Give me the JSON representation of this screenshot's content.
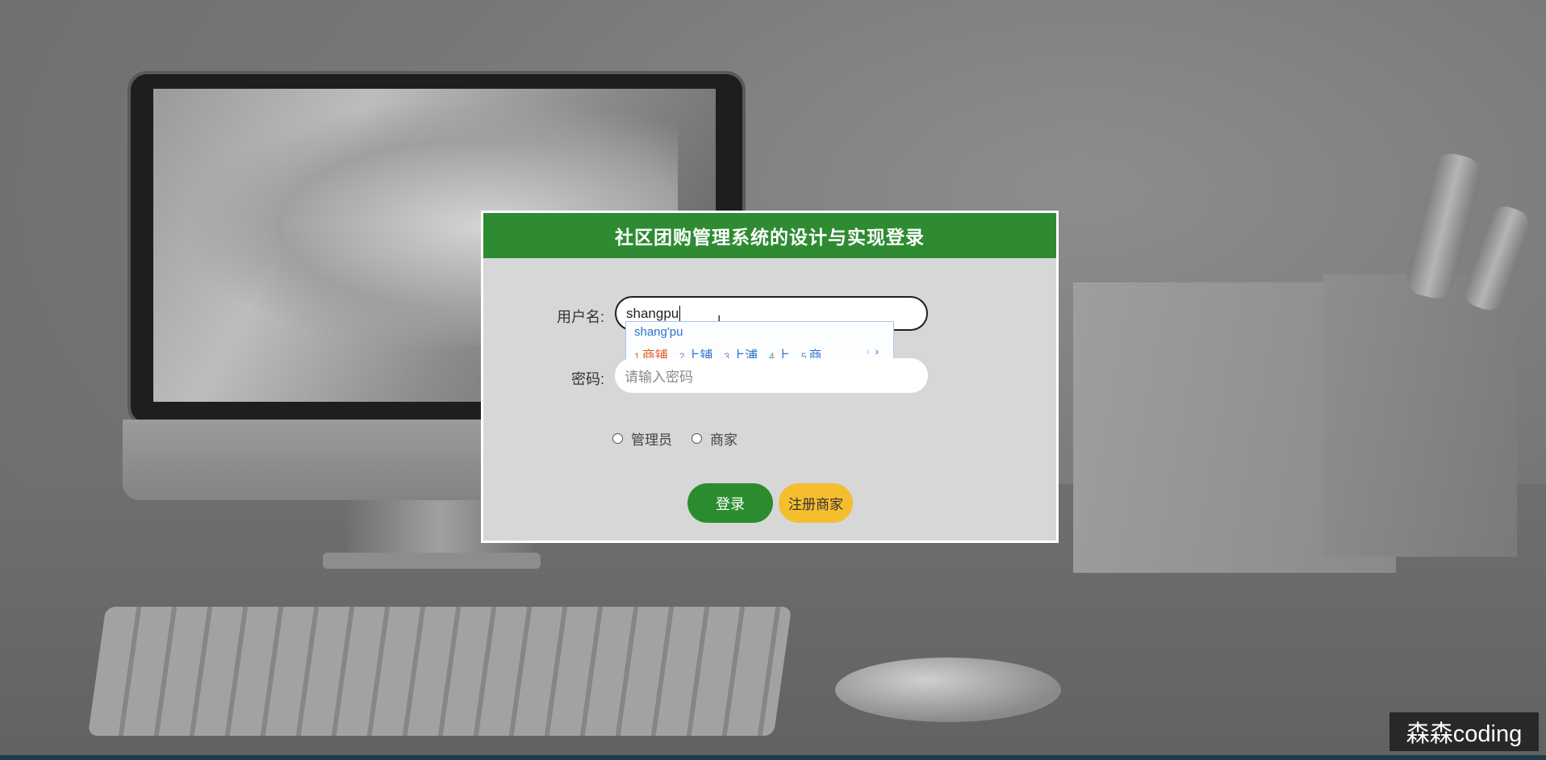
{
  "dialog": {
    "title": "社区团购管理系统的设计与实现登录",
    "username_label": "用户名:",
    "username_value": "shangpu",
    "password_label": "密码:",
    "password_placeholder": "请输入密码",
    "roles": [
      {
        "label": "管理员",
        "selected": false
      },
      {
        "label": "商家",
        "selected": false
      }
    ],
    "login_button": "登录",
    "register_button": "注册商家"
  },
  "ime": {
    "composition": "shang'pu",
    "candidates": [
      {
        "num": "1",
        "text": "商铺"
      },
      {
        "num": "2",
        "text": "上铺"
      },
      {
        "num": "3",
        "text": "上浦"
      },
      {
        "num": "4",
        "text": "上"
      },
      {
        "num": "5",
        "text": "商"
      }
    ],
    "prev": "‹",
    "next": "›"
  },
  "watermark": "森森coding",
  "colors": {
    "header_green": "#2e8b32",
    "login_green": "#2b8c2f",
    "register_yellow": "#f5be2f"
  }
}
